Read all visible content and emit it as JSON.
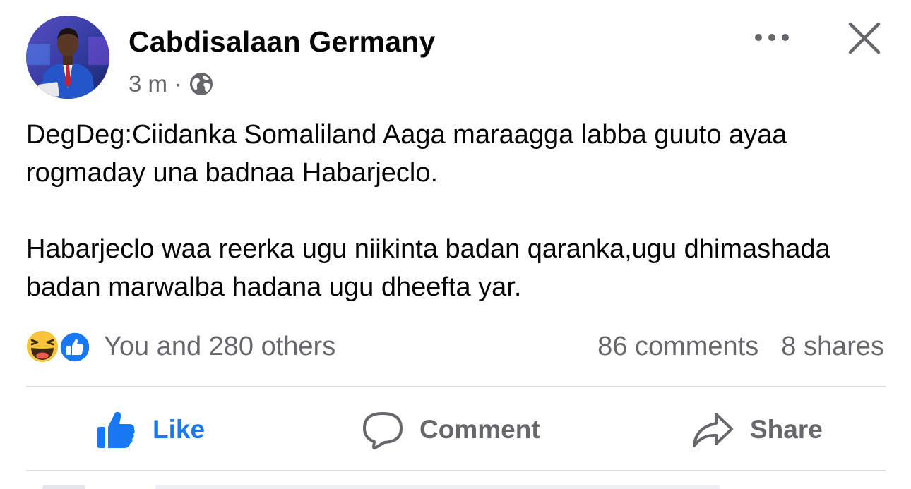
{
  "post": {
    "author_name": "Cabdisalaan Germany",
    "timestamp": "3 m",
    "separator": "·",
    "audience_icon": "globe-icon",
    "body": [
      "DegDeg:Ciidanka Somaliland Aaga maraagga labba guuto ayaa rogmaday una badnaa Habarjeclo.",
      "Habarjeclo waa reerka ugu niikinta badan qaranka,ugu dhimashada badan marwalba hadana ugu dheefta yar."
    ]
  },
  "header_icons": {
    "more": "more-horizontal-icon",
    "close": "close-icon"
  },
  "engagement": {
    "reaction_icons": [
      "haha-icon",
      "like-reaction-icon"
    ],
    "reactions_text": "You and 280 others",
    "comments": "86 comments",
    "shares": "8 shares"
  },
  "actions": {
    "like": "Like",
    "comment": "Comment",
    "share": "Share"
  },
  "colors": {
    "accent": "#1877f2",
    "secondary_text": "#65676b",
    "divider": "#dadde1",
    "haha_yellow": "#f7c43b"
  }
}
